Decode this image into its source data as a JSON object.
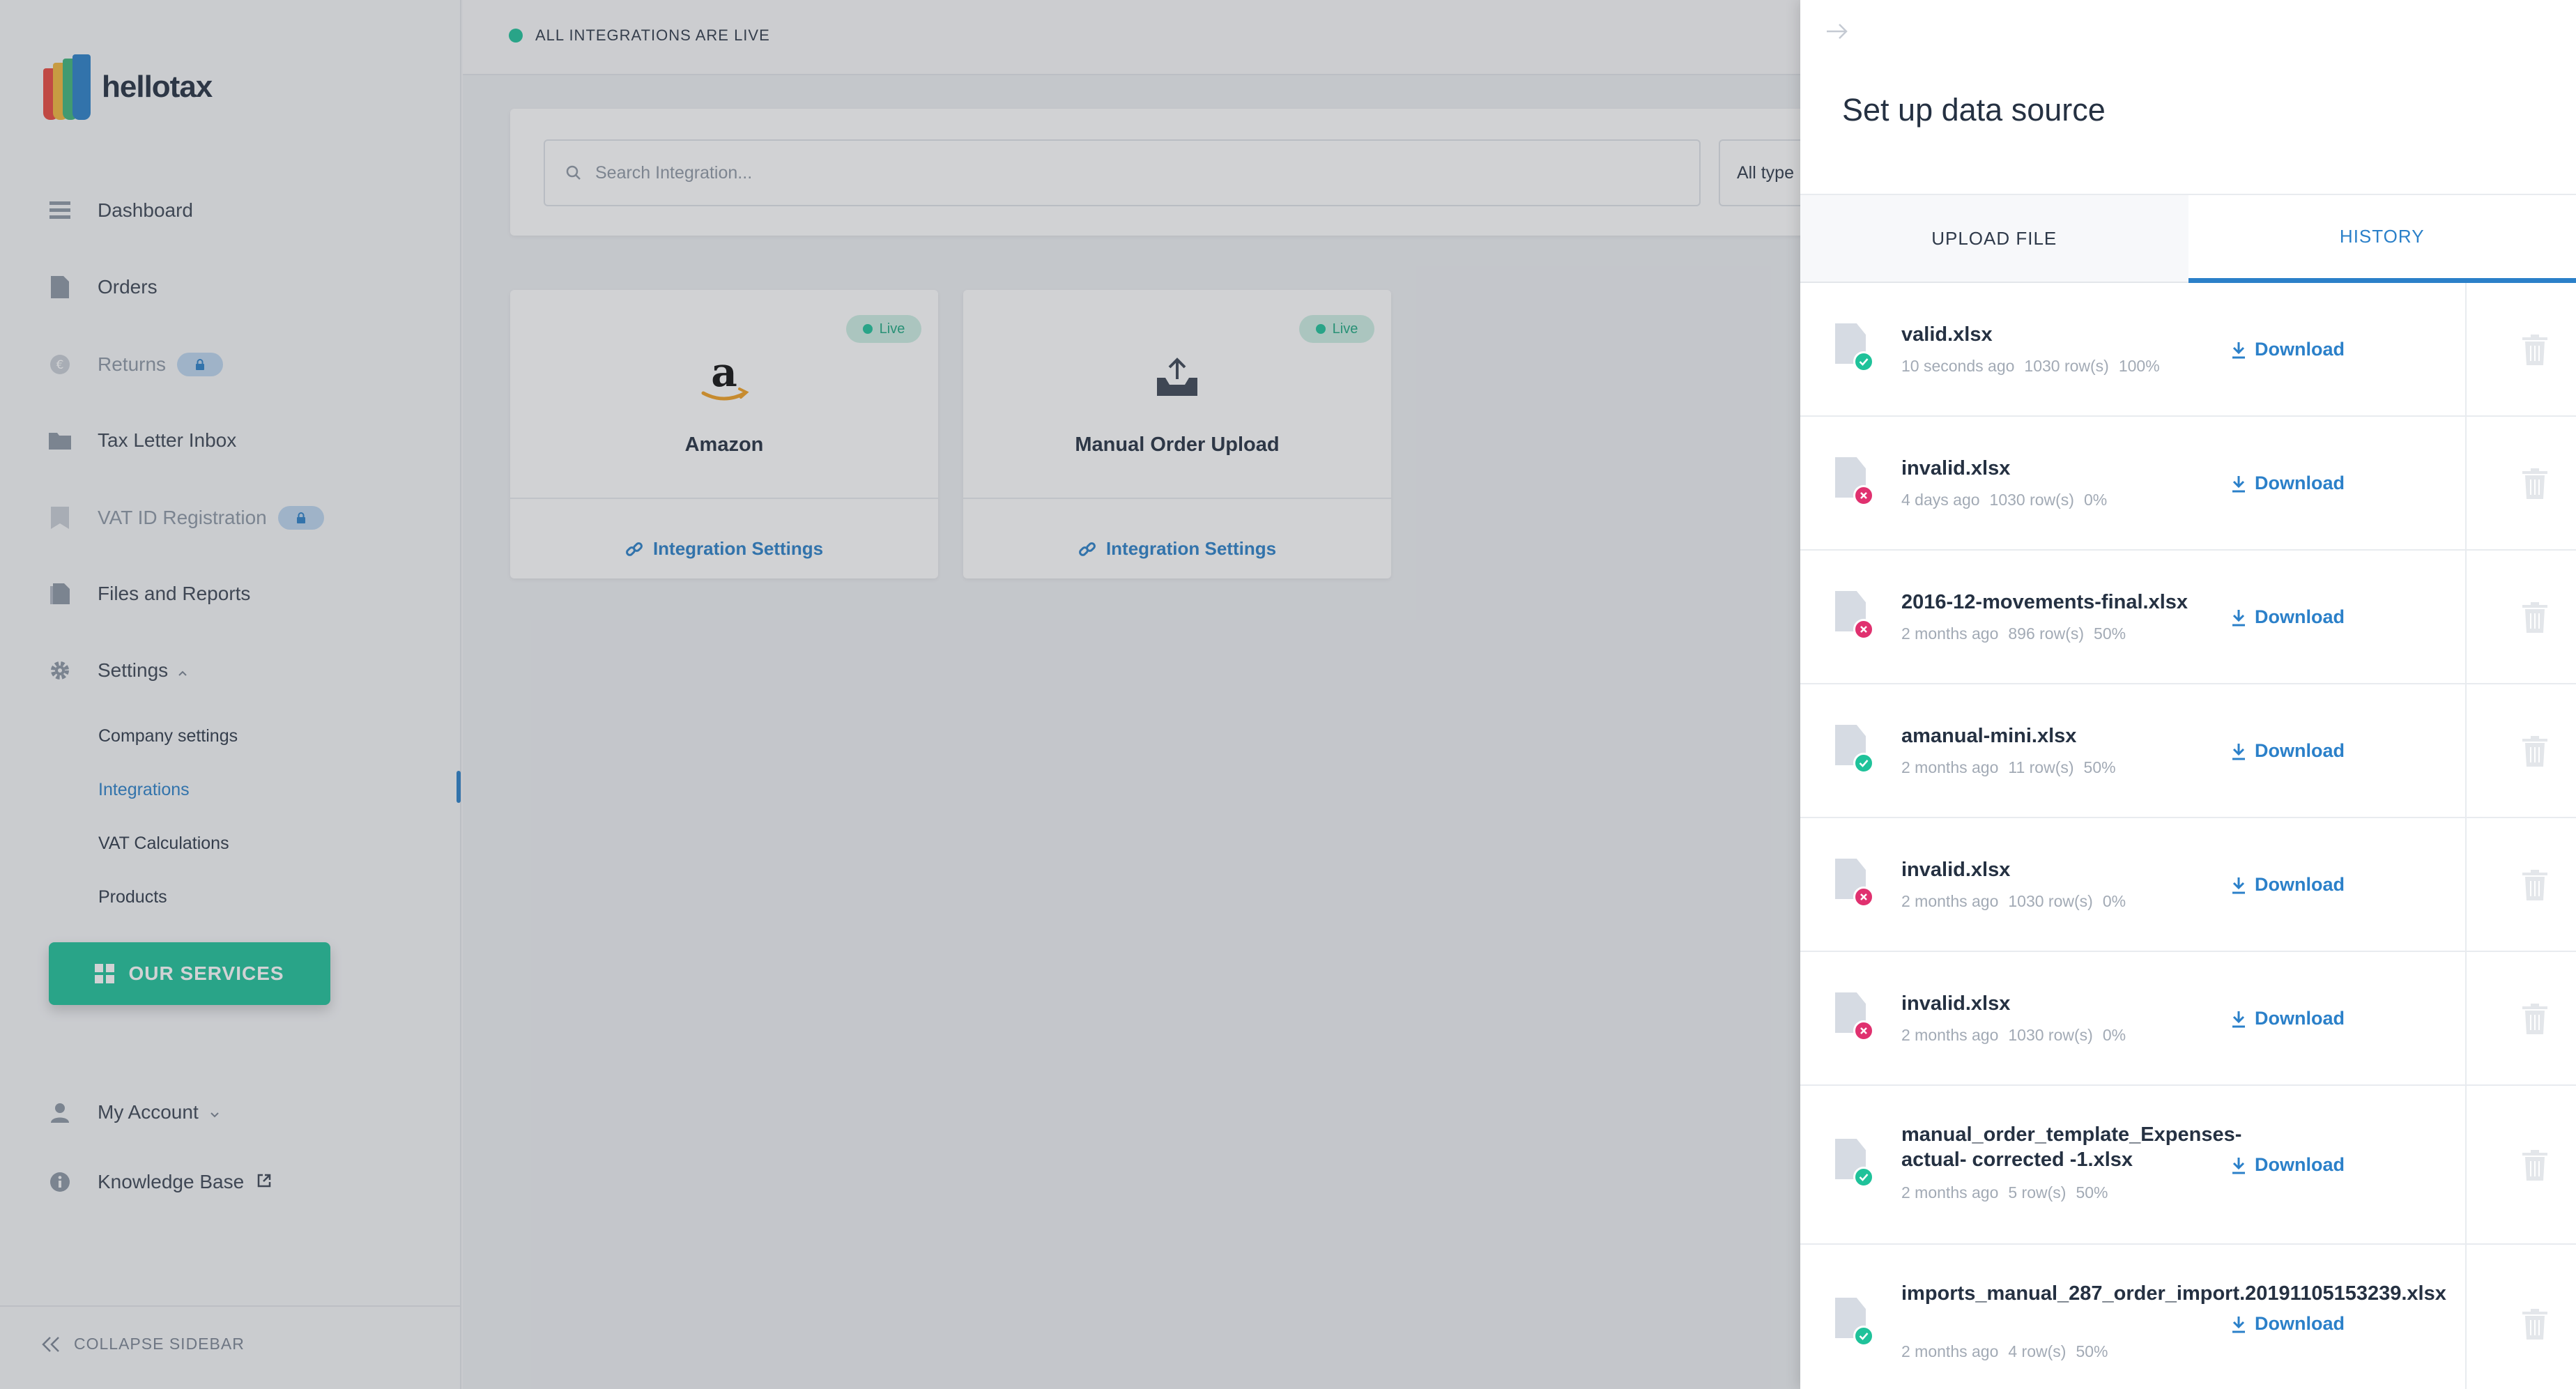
{
  "brand": {
    "name": "hellotax"
  },
  "sidebar": {
    "items": [
      {
        "label": "Dashboard",
        "icon": "dashboard-icon",
        "locked": false,
        "dim": false
      },
      {
        "label": "Orders",
        "icon": "document-icon",
        "locked": false,
        "dim": false
      },
      {
        "label": "Returns",
        "icon": "euro-icon",
        "locked": true,
        "dim": true
      },
      {
        "label": "Tax Letter Inbox",
        "icon": "folder-icon",
        "locked": false,
        "dim": false
      },
      {
        "label": "VAT ID Registration",
        "icon": "bookmark-icon",
        "locked": true,
        "dim": true
      },
      {
        "label": "Files and Reports",
        "icon": "files-icon",
        "locked": false,
        "dim": false
      },
      {
        "label": "Settings",
        "icon": "gear-icon",
        "locked": false,
        "dim": false
      }
    ],
    "settings_sub": [
      {
        "label": "Company settings",
        "active": false
      },
      {
        "label": "Integrations",
        "active": true
      },
      {
        "label": "VAT Calculations",
        "active": false
      },
      {
        "label": "Products",
        "active": false
      }
    ],
    "services_label": "OUR SERVICES",
    "account_label": "My Account",
    "knowledge_label": "Knowledge Base",
    "collapse_label": "COLLAPSE SIDEBAR"
  },
  "main": {
    "status": "ALL INTEGRATIONS ARE LIVE",
    "search_placeholder": "Search Integration...",
    "type_filter": "All type",
    "cards": [
      {
        "title": "Amazon",
        "badge": "Live",
        "link": "Integration Settings",
        "icon": "amazon-logo-icon"
      },
      {
        "title": "Manual Order Upload",
        "badge": "Live",
        "link": "Integration Settings",
        "icon": "inbox-upload-icon"
      }
    ]
  },
  "panel": {
    "title": "Set up data source",
    "tabs": [
      {
        "label": "UPLOAD FILE",
        "active": false
      },
      {
        "label": "HISTORY",
        "active": true
      }
    ],
    "download_label": "Download",
    "files": [
      {
        "name": "valid.xlsx",
        "time": "10 seconds ago",
        "rows": "1030 row(s)",
        "percent": "100%",
        "status": "success"
      },
      {
        "name": "invalid.xlsx",
        "time": "4 days ago",
        "rows": "1030 row(s)",
        "percent": "0%",
        "status": "error"
      },
      {
        "name": "2016-12-movements-final.xlsx",
        "time": "2 months ago",
        "rows": "896 row(s)",
        "percent": "50%",
        "status": "error"
      },
      {
        "name": "amanual-mini.xlsx",
        "time": "2 months ago",
        "rows": "11 row(s)",
        "percent": "50%",
        "status": "success"
      },
      {
        "name": "invalid.xlsx",
        "time": "2 months ago",
        "rows": "1030 row(s)",
        "percent": "0%",
        "status": "error"
      },
      {
        "name": "invalid.xlsx",
        "time": "2 months ago",
        "rows": "1030 row(s)",
        "percent": "0%",
        "status": "error"
      },
      {
        "name": "manual_order_template_Expenses-actual- corrected -1.xlsx",
        "time": "2 months ago",
        "rows": "5 row(s)",
        "percent": "50%",
        "status": "success"
      },
      {
        "name": "imports_manual_287_order_import.20191105153239.xlsx",
        "time": "2 months ago",
        "rows": "4 row(s)",
        "percent": "50%",
        "status": "success"
      }
    ]
  },
  "colors": {
    "accent": "#2b80c9",
    "success": "#1fc29a",
    "error": "#e0316f",
    "services": "#1fc29a"
  }
}
